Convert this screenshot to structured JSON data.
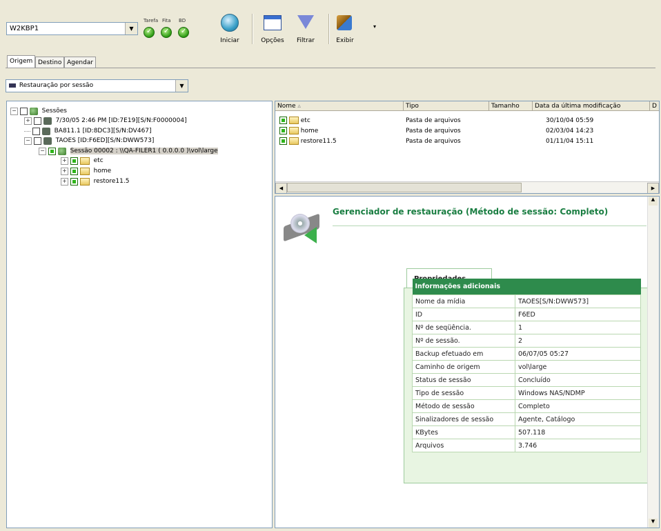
{
  "toolbar": {
    "server": "W2KBP1",
    "status_labels": [
      "Tarefa",
      "Fita",
      "BD"
    ],
    "buttons": [
      {
        "label": "Iniciar",
        "icon": "start-globe-icon"
      },
      {
        "label": "Opções",
        "icon": "options-window-icon"
      },
      {
        "label": "Filtrar",
        "icon": "filter-funnel-icon"
      },
      {
        "label": "Exibir",
        "icon": "view-icon"
      }
    ]
  },
  "tabs": [
    "Origem",
    "Destino",
    "Agendar"
  ],
  "method": "Restauração por sessão",
  "tree": [
    {
      "label": "Sessões"
    },
    {
      "label": "7/30/05 2:46 PM [ID:7E19][S/N:F0000004]"
    },
    {
      "label": "BA811.1 [ID:8DC3][S/N:DV467]"
    },
    {
      "label": "TAOES [ID:F6ED][S/N:DWW573]"
    },
    {
      "label": "Sessão 00002 : \\\\QA-FILER1 ( 0.0.0.0 )\\vol\\large"
    },
    {
      "label": "etc"
    },
    {
      "label": "home"
    },
    {
      "label": "restore11.5"
    }
  ],
  "list": {
    "columns": [
      "Nome",
      "Tipo",
      "Tamanho",
      "Data da última modificação",
      "D"
    ],
    "rows": [
      {
        "name": "etc",
        "type": "Pasta de arquivos",
        "size": "",
        "date": "30/10/04 05:59"
      },
      {
        "name": "home",
        "type": "Pasta de arquivos",
        "size": "",
        "date": "02/03/04 14:23"
      },
      {
        "name": "restore11.5",
        "type": "Pasta de arquivos",
        "size": "",
        "date": "01/11/04 15:11"
      }
    ]
  },
  "detail": {
    "title": "Gerenciador de restauração (Método de sessão: Completo)",
    "tab": "Propriedades",
    "table_header": "Informações adicionais",
    "rows": [
      {
        "k": "Nome da mídia",
        "v": "TAOES[S/N:DWW573]"
      },
      {
        "k": "ID",
        "v": "F6ED"
      },
      {
        "k": "Nº de seqüência.",
        "v": "1"
      },
      {
        "k": "Nº de sessão.",
        "v": "2"
      },
      {
        "k": "Backup efetuado em",
        "v": "06/07/05 05:27"
      },
      {
        "k": "Caminho de origem",
        "v": "vol\\large"
      },
      {
        "k": "Status de sessão",
        "v": "Concluído"
      },
      {
        "k": "Tipo de sessão",
        "v": "Windows NAS/NDMP"
      },
      {
        "k": "Método de sessão",
        "v": "Completo"
      },
      {
        "k": "Sinalizadores de sessão",
        "v": "Agente, Catálogo"
      },
      {
        "k": "KBytes",
        "v": "507.118"
      },
      {
        "k": "Arquivos",
        "v": "3.746"
      }
    ]
  }
}
